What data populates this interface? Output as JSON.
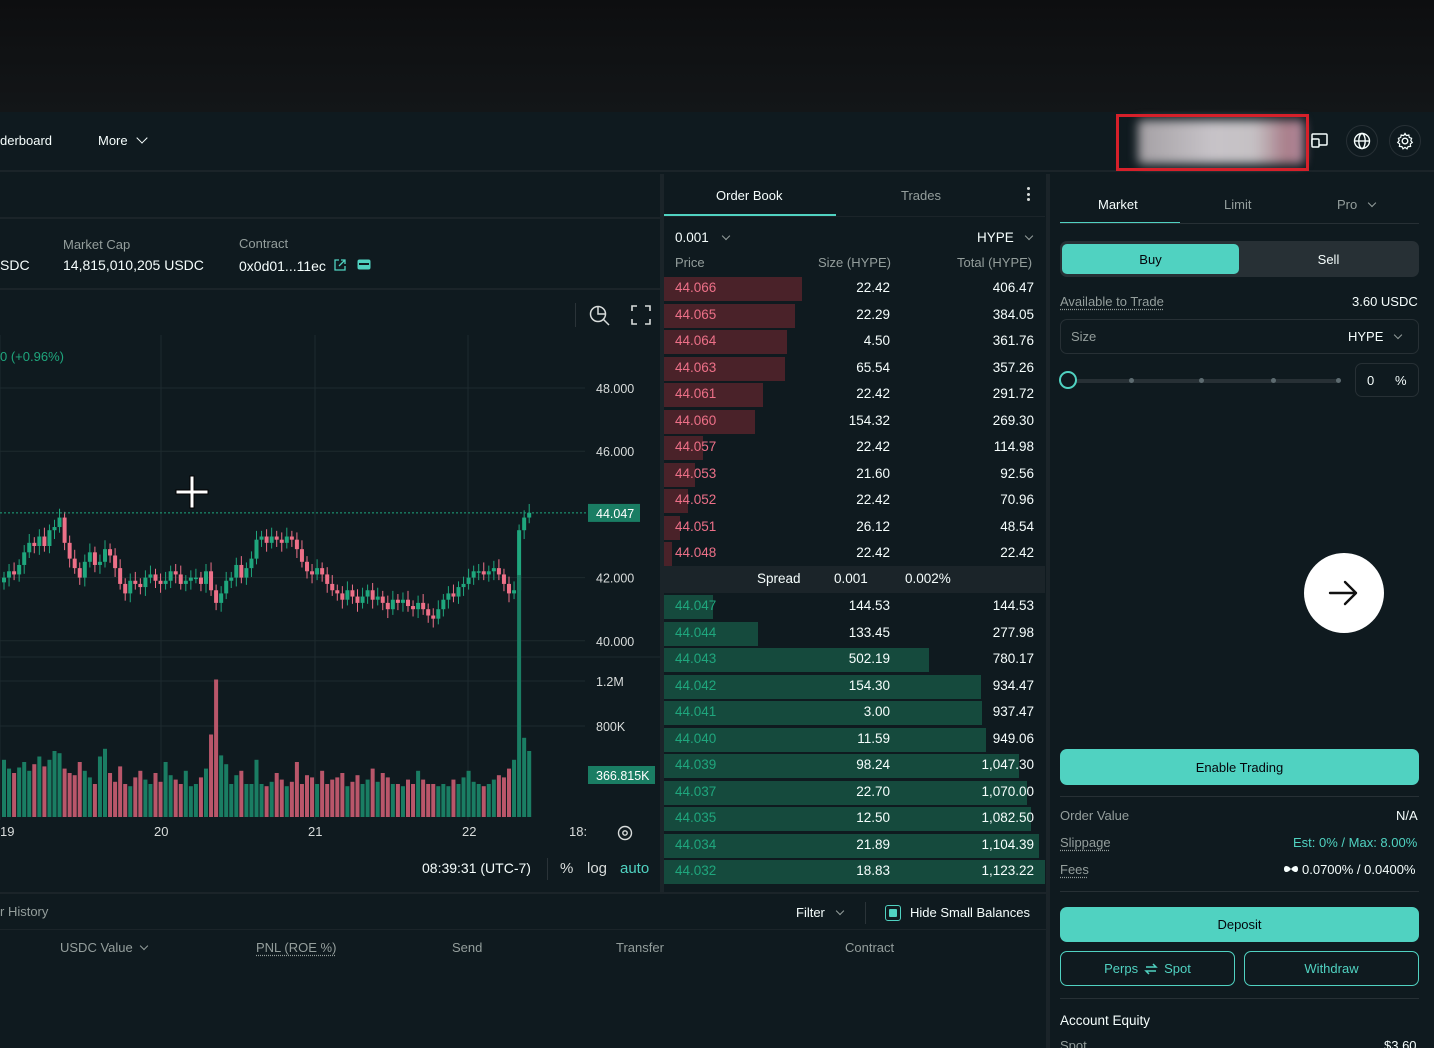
{
  "nav": {
    "leaderboard": "derboard",
    "more": "More"
  },
  "stats": {
    "partial_value": "SDC",
    "market_cap_label": "Market Cap",
    "market_cap_value": "14,815,010,205 USDC",
    "contract_label": "Contract",
    "contract_value": "0x0d01...11ec"
  },
  "chart": {
    "change_text": "0 (+0.96%)",
    "price_label": "44.047",
    "volume_label": "366.815K",
    "price_ticks": [
      "48.000",
      "46.000",
      "42.000",
      "40.000"
    ],
    "volume_ticks": [
      "1.2M",
      "800K"
    ],
    "x_ticks": [
      "19",
      "20",
      "21",
      "22",
      "18:"
    ],
    "time": "08:39:31 (UTC-7)",
    "percent": "%",
    "log": "log",
    "auto": "auto"
  },
  "chart_data": {
    "type": "candlestick",
    "ylim": [
      39.5,
      49.5
    ],
    "last_price": 44.047,
    "x_ticks": [
      "19",
      "20",
      "21",
      "22",
      "18:"
    ],
    "y_ticks": [
      48,
      46,
      42,
      40
    ],
    "volume_ticks": [
      "1.2M",
      "800K"
    ],
    "last_volume": "366.815K",
    "close": [
      42.0,
      42.2,
      42.1,
      42.4,
      42.8,
      43.1,
      43.0,
      43.3,
      43.0,
      43.5,
      43.6,
      43.9,
      43.1,
      42.6,
      42.3,
      42.0,
      42.5,
      42.8,
      42.4,
      42.5,
      42.9,
      42.7,
      42.3,
      41.8,
      41.5,
      41.9,
      41.8,
      41.7,
      42.0,
      42.1,
      41.9,
      41.8,
      41.9,
      42.2,
      42.1,
      41.8,
      41.9,
      42.0,
      42.0,
      41.8,
      42.2,
      41.6,
      41.2,
      41.5,
      41.9,
      42.0,
      42.4,
      42.0,
      42.3,
      42.6,
      43.2,
      43.3,
      43.1,
      43.3,
      43.2,
      43.1,
      43.3,
      43.2,
      42.9,
      42.5,
      42.2,
      42.1,
      42.3,
      42.1,
      41.8,
      41.6,
      41.5,
      41.3,
      41.6,
      41.4,
      41.2,
      41.4,
      41.6,
      41.3,
      41.4,
      41.2,
      41.0,
      41.3,
      41.2,
      41.3,
      41.1,
      41.0,
      41.2,
      41.0,
      40.8,
      40.7,
      41.0,
      41.3,
      41.5,
      41.4,
      41.7,
      41.8,
      42.0,
      42.2,
      42.2,
      42.1,
      42.2,
      42.3,
      42.1,
      41.8,
      41.5,
      41.6,
      43.5,
      43.9,
      44.05
    ],
    "volume": [
      0.52,
      0.44,
      0.4,
      0.45,
      0.5,
      0.42,
      0.48,
      0.55,
      0.46,
      0.52,
      0.6,
      0.58,
      0.44,
      0.4,
      0.38,
      0.5,
      0.42,
      0.36,
      0.3,
      0.55,
      0.62,
      0.4,
      0.32,
      0.46,
      0.3,
      0.28,
      0.36,
      0.42,
      0.34,
      0.3,
      0.4,
      0.32,
      0.5,
      0.38,
      0.34,
      0.3,
      0.42,
      0.28,
      0.3,
      0.36,
      0.44,
      0.75,
      1.25,
      0.56,
      0.48,
      0.3,
      0.38,
      0.42,
      0.3,
      0.3,
      0.52,
      0.3,
      0.28,
      0.32,
      0.4,
      0.34,
      0.28,
      0.32,
      0.5,
      0.3,
      0.38,
      0.36,
      0.3,
      0.42,
      0.3,
      0.34,
      0.36,
      0.4,
      0.28,
      0.32,
      0.38,
      0.3,
      0.34,
      0.44,
      0.32,
      0.4,
      0.36,
      0.3,
      0.3,
      0.28,
      0.34,
      0.3,
      0.42,
      0.34,
      0.3,
      0.3,
      0.28,
      0.3,
      0.28,
      0.34,
      0.3,
      0.36,
      0.42,
      0.32,
      0.3,
      0.28,
      0.3,
      0.34,
      0.38,
      0.36,
      0.44,
      0.52,
      2.2,
      0.72,
      0.6
    ]
  },
  "orderbook": {
    "tabs": [
      "Order Book",
      "Trades"
    ],
    "tick": "0.001",
    "asset": "HYPE",
    "headers": [
      "Price",
      "Size (HYPE)",
      "Total (HYPE)"
    ],
    "asks": [
      {
        "price": "44.066",
        "size": "22.42",
        "total": "406.47",
        "depth": 0.363
      },
      {
        "price": "44.065",
        "size": "22.29",
        "total": "384.05",
        "depth": 0.343
      },
      {
        "price": "44.064",
        "size": "4.50",
        "total": "361.76",
        "depth": 0.323
      },
      {
        "price": "44.063",
        "size": "65.54",
        "total": "357.26",
        "depth": 0.318
      },
      {
        "price": "44.061",
        "size": "22.42",
        "total": "291.72",
        "depth": 0.26
      },
      {
        "price": "44.060",
        "size": "154.32",
        "total": "269.30",
        "depth": 0.24
      },
      {
        "price": "44.057",
        "size": "22.42",
        "total": "114.98",
        "depth": 0.102
      },
      {
        "price": "44.053",
        "size": "21.60",
        "total": "92.56",
        "depth": 0.082
      },
      {
        "price": "44.052",
        "size": "22.42",
        "total": "70.96",
        "depth": 0.063
      },
      {
        "price": "44.051",
        "size": "26.12",
        "total": "48.54",
        "depth": 0.043
      },
      {
        "price": "44.048",
        "size": "22.42",
        "total": "22.42",
        "depth": 0.02
      }
    ],
    "spread_label": "Spread",
    "spread_value": "0.001",
    "spread_pct": "0.002%",
    "bids": [
      {
        "price": "44.047",
        "size": "144.53",
        "total": "144.53",
        "depth": 0.129
      },
      {
        "price": "44.044",
        "size": "133.45",
        "total": "277.98",
        "depth": 0.248
      },
      {
        "price": "44.043",
        "size": "502.19",
        "total": "780.17",
        "depth": 0.695
      },
      {
        "price": "44.042",
        "size": "154.30",
        "total": "934.47",
        "depth": 0.832
      },
      {
        "price": "44.041",
        "size": "3.00",
        "total": "937.47",
        "depth": 0.835
      },
      {
        "price": "44.040",
        "size": "11.59",
        "total": "949.06",
        "depth": 0.845
      },
      {
        "price": "44.039",
        "size": "98.24",
        "total": "1,047.30",
        "depth": 0.933
      },
      {
        "price": "44.037",
        "size": "22.70",
        "total": "1,070.00",
        "depth": 0.953
      },
      {
        "price": "44.035",
        "size": "12.50",
        "total": "1,082.50",
        "depth": 0.964
      },
      {
        "price": "44.034",
        "size": "21.89",
        "total": "1,104.39",
        "depth": 0.984
      },
      {
        "price": "44.032",
        "size": "18.83",
        "total": "1,123.22",
        "depth": 1.0
      }
    ]
  },
  "trade": {
    "tabs": [
      "Market",
      "Limit",
      "Pro"
    ],
    "buy": "Buy",
    "sell": "Sell",
    "available_label": "Available to Trade",
    "available_value": "3.60 USDC",
    "size_placeholder": "Size",
    "size_unit": "HYPE",
    "pct_value": "0",
    "pct_symbol": "%",
    "enable": "Enable Trading",
    "order_value_label": "Order Value",
    "order_value": "N/A",
    "slippage_label": "Slippage",
    "slippage_value": "Est: 0% / Max: 8.00%",
    "fees_label": "Fees",
    "fees_value": "0.0700% / 0.0400%",
    "deposit": "Deposit",
    "perps": "Perps",
    "spot": "Spot",
    "withdraw": "Withdraw",
    "equity_label": "Account Equity",
    "spot_label": "Spot",
    "spot_value": "$3.60"
  },
  "bottom": {
    "history_tab": "r History",
    "filter": "Filter",
    "hide_small": "Hide Small Balances",
    "columns": [
      "USDC Value",
      "PNL (ROE %)",
      "Send",
      "Transfer",
      "Contract"
    ]
  },
  "colors": {
    "accent": "#50d2c1",
    "ask": "#ed7088",
    "bid": "#1fa67d",
    "bg": "#0f1a1f"
  }
}
